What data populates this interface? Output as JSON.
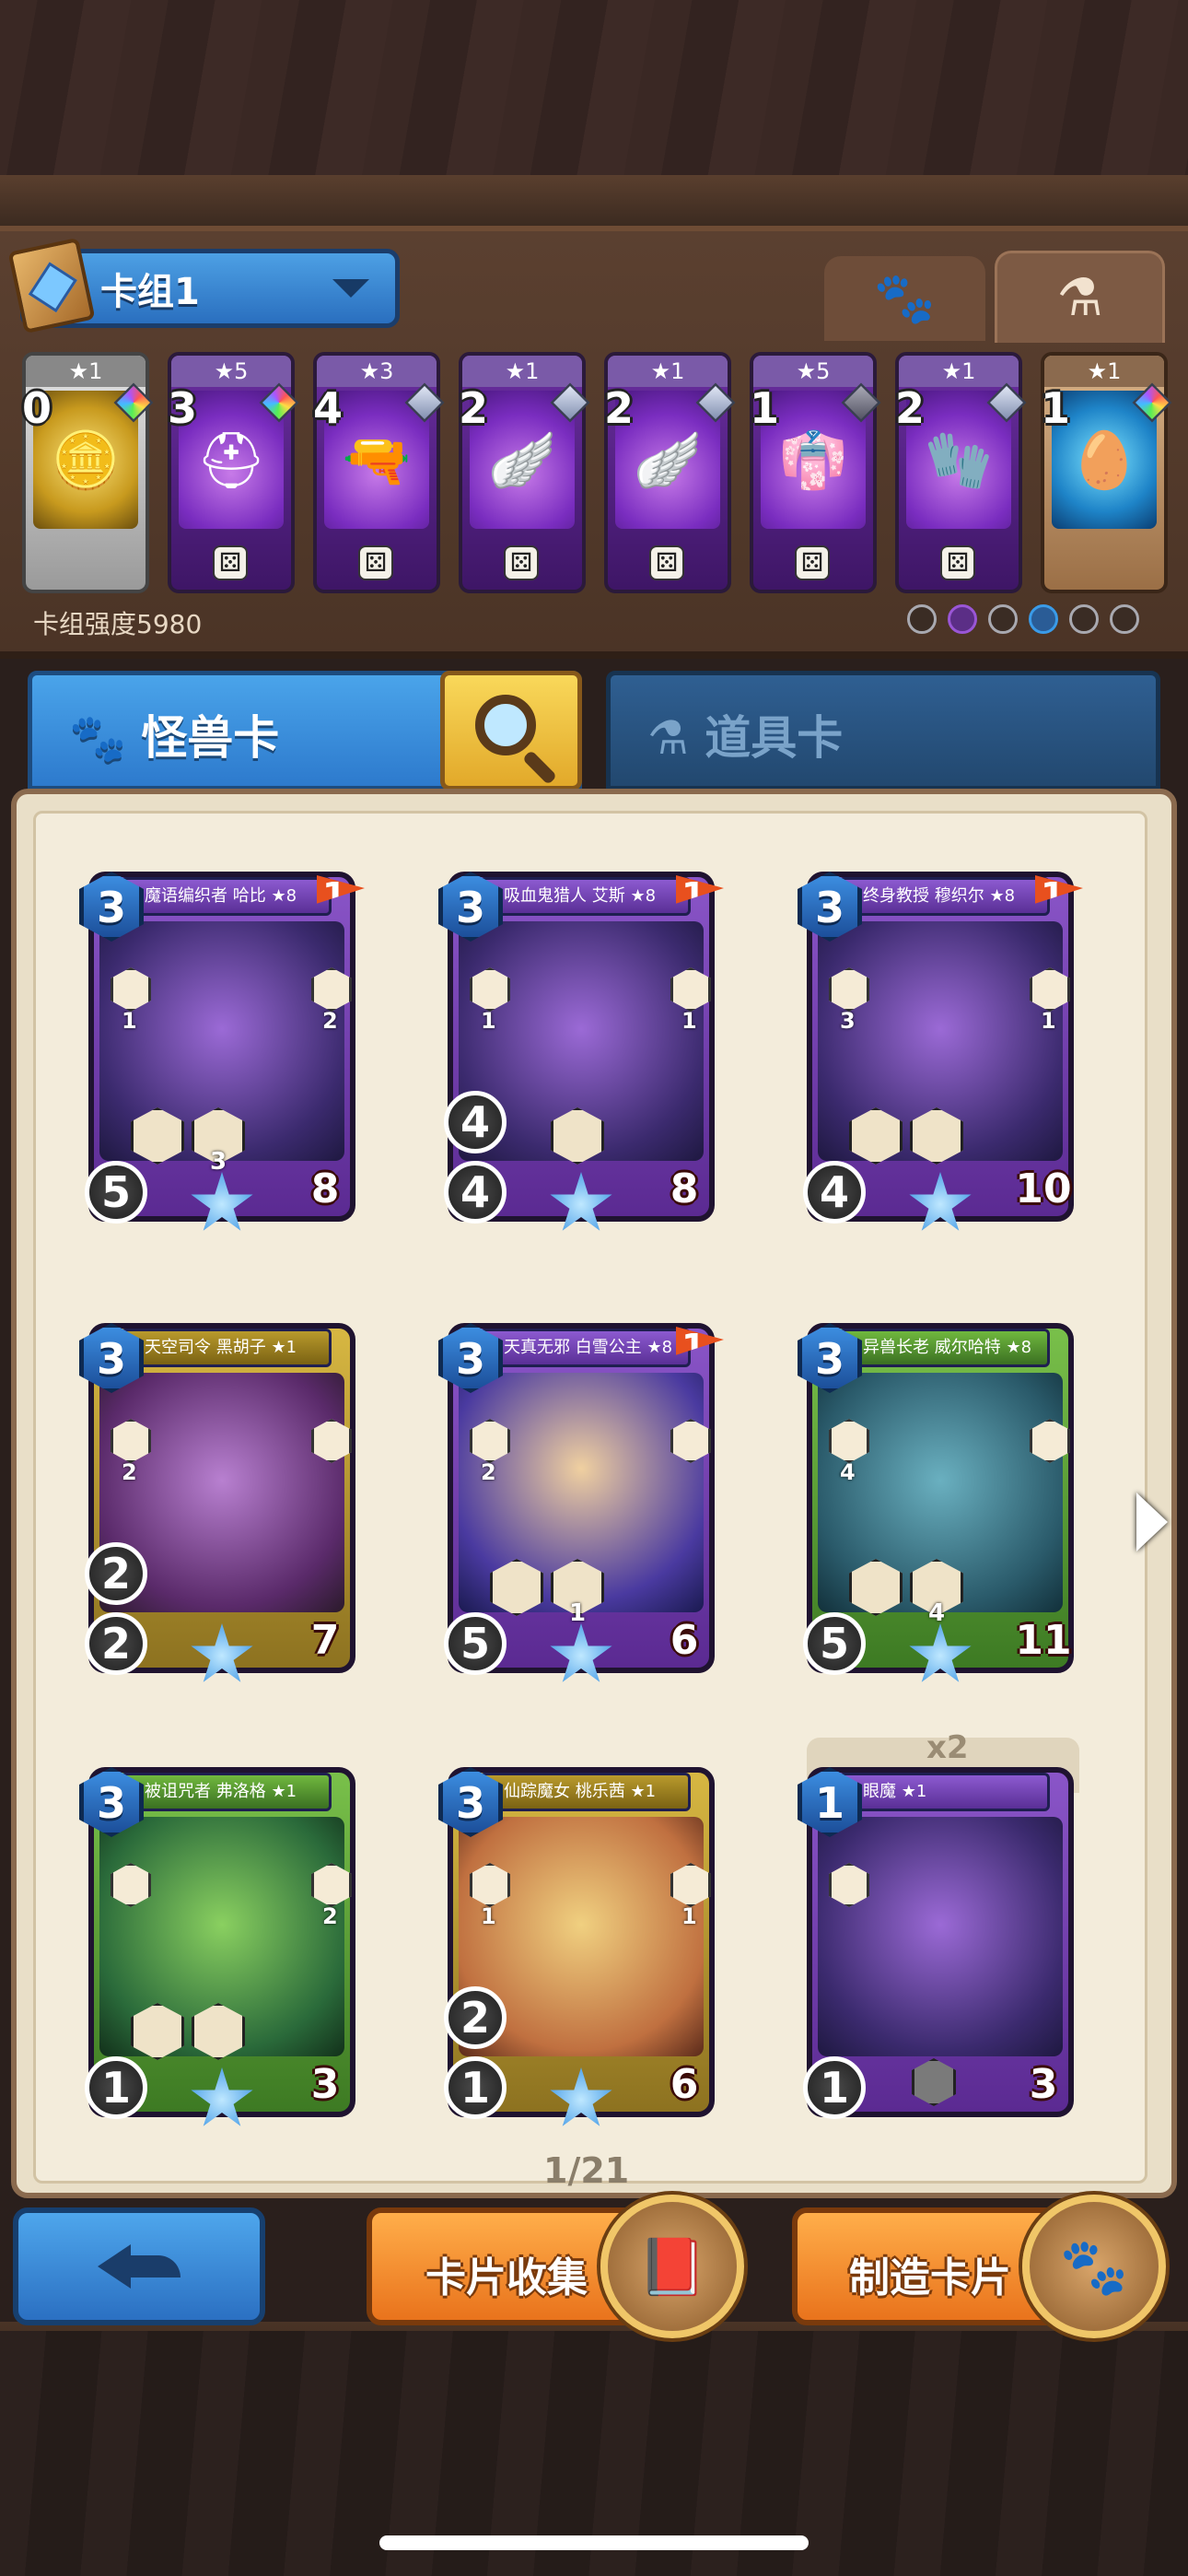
{
  "deck": {
    "name": "卡组1",
    "strength_label": "卡组强度5980",
    "cards": [
      {
        "stars": "★1",
        "cost": "0",
        "gem": "rainbow",
        "style": "gray",
        "icon": "coin-icon"
      },
      {
        "stars": "★5",
        "cost": "3",
        "gem": "rainbow",
        "style": "purple",
        "icon": "helmet-icon"
      },
      {
        "stars": "★3",
        "cost": "4",
        "gem": "silver",
        "style": "purple",
        "icon": "pistol-icon"
      },
      {
        "stars": "★1",
        "cost": "2",
        "gem": "silver",
        "style": "purple",
        "icon": "wing-icon"
      },
      {
        "stars": "★1",
        "cost": "2",
        "gem": "silver",
        "style": "purple",
        "icon": "wing-icon"
      },
      {
        "stars": "★5",
        "cost": "1",
        "gem": "dark",
        "style": "purple",
        "icon": "robe-icon"
      },
      {
        "stars": "★1",
        "cost": "2",
        "gem": "silver",
        "style": "purple",
        "icon": "gauntlet-icon"
      },
      {
        "stars": "★1",
        "cost": "1",
        "gem": "rainbow",
        "style": "tan",
        "icon": "egg-icon"
      }
    ]
  },
  "tabs": {
    "monster": "怪兽卡",
    "item": "道具卡"
  },
  "cards": [
    {
      "title": "魔语编织者 哈比 ★8",
      "cost": "3",
      "flag": "1",
      "left_num": "1",
      "right_num": "2",
      "skill_num": "3",
      "spd": "",
      "atk": "5",
      "hp": "8",
      "frame": "purple"
    },
    {
      "title": "吸血鬼猎人 艾斯 ★8",
      "cost": "3",
      "flag": "1",
      "left_num": "1",
      "right_num": "1",
      "skill_num": "",
      "spd": "4",
      "atk": "4",
      "hp": "8",
      "frame": "purple"
    },
    {
      "title": "终身教授 穆织尔 ★8",
      "cost": "3",
      "flag": "1",
      "left_num": "3",
      "right_num": "1",
      "skill_num": "",
      "spd": "",
      "atk": "4",
      "hp": "10",
      "frame": "purple"
    },
    {
      "title": "天空司令 黑胡子 ★1",
      "cost": "3",
      "flag": "",
      "left_num": "2",
      "right_num": "",
      "skill_num": "",
      "spd": "2",
      "atk": "2",
      "hp": "7",
      "frame": "gold"
    },
    {
      "title": "天真无邪 白雪公主 ★8",
      "cost": "3",
      "flag": "1",
      "left_num": "2",
      "right_num": "",
      "skill_num": "1",
      "spd": "",
      "atk": "5",
      "hp": "6",
      "frame": "purple"
    },
    {
      "title": "异兽长老 威尔哈特 ★8",
      "cost": "3",
      "flag": "",
      "left_num": "4",
      "right_num": "",
      "skill_num": "4",
      "spd": "",
      "atk": "5",
      "hp": "11",
      "frame": "green"
    },
    {
      "title": "被诅咒者 弗洛格 ★1",
      "cost": "3",
      "flag": "",
      "left_num": "",
      "right_num": "2",
      "skill_num": "",
      "spd": "",
      "atk": "1",
      "hp": "3",
      "frame": "green"
    },
    {
      "title": "仙踪魔女 桃乐茜 ★1",
      "cost": "3",
      "flag": "",
      "left_num": "1",
      "right_num": "1",
      "skill_num": "",
      "spd": "2",
      "atk": "1",
      "hp": "6",
      "frame": "gold"
    },
    {
      "title": "眼魔 ★1",
      "cost": "1",
      "flag": "",
      "left_num": "",
      "right_num": "",
      "skill_num": "",
      "spd": "",
      "atk": "1",
      "hp": "3",
      "frame": "purple"
    }
  ],
  "x2_label": "x2",
  "pagination": "1/21",
  "buttons": {
    "collection": "卡片收集",
    "craft": "制造卡片"
  }
}
